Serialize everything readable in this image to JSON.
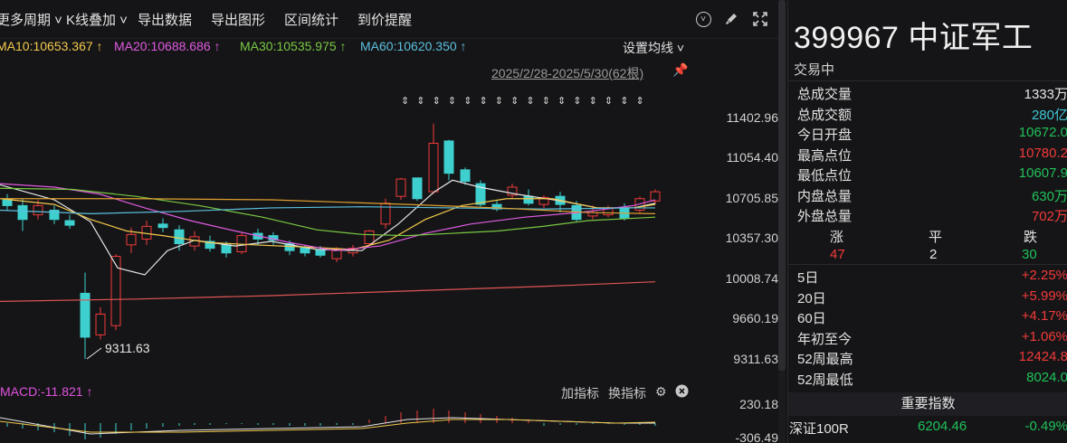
{
  "toolbar": {
    "more_periods": "更多周期",
    "kline_overlay": "K线叠加",
    "export_data": "导出数据",
    "export_chart": "导出图形",
    "range_stats": "区间统计",
    "price_alert": "到价提醒"
  },
  "ma_legend": {
    "ma10": "MA10:10653.367 ↑",
    "ma20": "MA20:10688.686 ↑",
    "ma30": "MA30:10535.975 ↑",
    "ma60": "MA60:10620.350 ↑",
    "settings": "设置均线",
    "colors": {
      "ma10": "#f2c94c",
      "ma20": "#e05be0",
      "ma30": "#7ac943",
      "ma60": "#5bc0de"
    }
  },
  "range_label": "2025/2/28-2025/5/30(62根)",
  "price_axis": [
    "11402.96",
    "11054.40",
    "10705.85",
    "10357.30",
    "10008.74",
    "9660.19",
    "9311.63"
  ],
  "low_annotation": "9311.63",
  "indicator": {
    "macd_label": "MACD:-11.821 ↑",
    "add_indicator": "加指标",
    "switch_indicator": "换指标",
    "axis_top": "230.18",
    "axis_bottom": "-306.49"
  },
  "quote": {
    "title": "399967 中证军工",
    "status": "交易中",
    "stats": [
      {
        "label": "总成交量",
        "value": "1333万",
        "color": "white"
      },
      {
        "label": "总成交额",
        "value": "280亿",
        "color": "cyan"
      },
      {
        "label": "今日开盘",
        "value": "10672.0",
        "color": "green"
      },
      {
        "label": "最高点位",
        "value": "10780.2",
        "color": "red"
      },
      {
        "label": "最低点位",
        "value": "10607.9",
        "color": "green"
      },
      {
        "label": "内盘总量",
        "value": "630万",
        "color": "green"
      },
      {
        "label": "外盘总量",
        "value": "702万",
        "color": "red"
      }
    ],
    "breadth": {
      "up_label": "涨",
      "flat_label": "平",
      "down_label": "跌",
      "up": "47",
      "flat": "2",
      "down": "30"
    },
    "changes": [
      {
        "label": "5日",
        "value": "+2.25%",
        "color": "red"
      },
      {
        "label": "20日",
        "value": "+5.99%",
        "color": "red"
      },
      {
        "label": "60日",
        "value": "+4.17%",
        "color": "red"
      },
      {
        "label": "年初至今",
        "value": "+1.06%",
        "color": "red"
      },
      {
        "label": "52周最高",
        "value": "12424.8",
        "color": "red"
      },
      {
        "label": "52周最低",
        "value": "8024.0",
        "color": "green"
      }
    ],
    "important_index_head": "重要指数",
    "index_row": {
      "name": "深证100R",
      "value": "6204.46",
      "change": "-0.49%"
    }
  }
}
